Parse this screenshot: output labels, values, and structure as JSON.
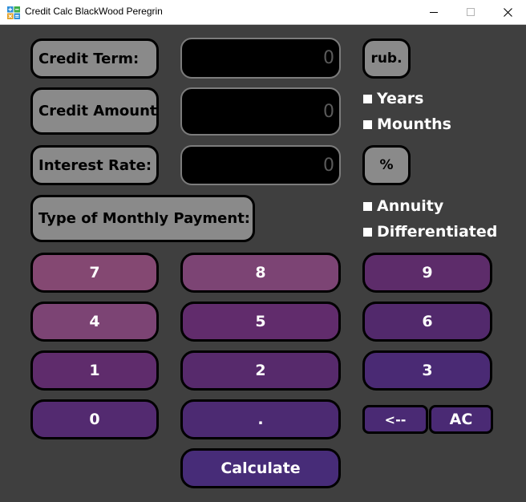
{
  "window": {
    "title": "Credit Calc BlackWood Peregrin"
  },
  "labels": {
    "credit_term": "Credit Term:",
    "credit_amount": "Credit Amount:",
    "interest_rate": "Interest Rate:",
    "payment_type": "Type of Monthly Payment:"
  },
  "fields": {
    "credit_term": "0",
    "credit_amount": "0",
    "interest_rate": "0"
  },
  "units": {
    "currency": "rub.",
    "percent": "%"
  },
  "term_options": [
    "Years",
    "Mounths"
  ],
  "payment_options": [
    "Annuity",
    "Differentiated"
  ],
  "keys": {
    "k7": "7",
    "k8": "8",
    "k9": "9",
    "k4": "4",
    "k5": "5",
    "k6": "6",
    "k1": "1",
    "k2": "2",
    "k3": "3",
    "k0": "0",
    "dot": ".",
    "backspace": "<--",
    "clear": "AC",
    "calculate": "Calculate"
  },
  "colors": {
    "background": "#3f3f3f",
    "label_gray": "#8a8a8a",
    "pink": "#844872",
    "violet": "#612c6c",
    "purple": "#532a70",
    "indigo": "#472c78"
  }
}
